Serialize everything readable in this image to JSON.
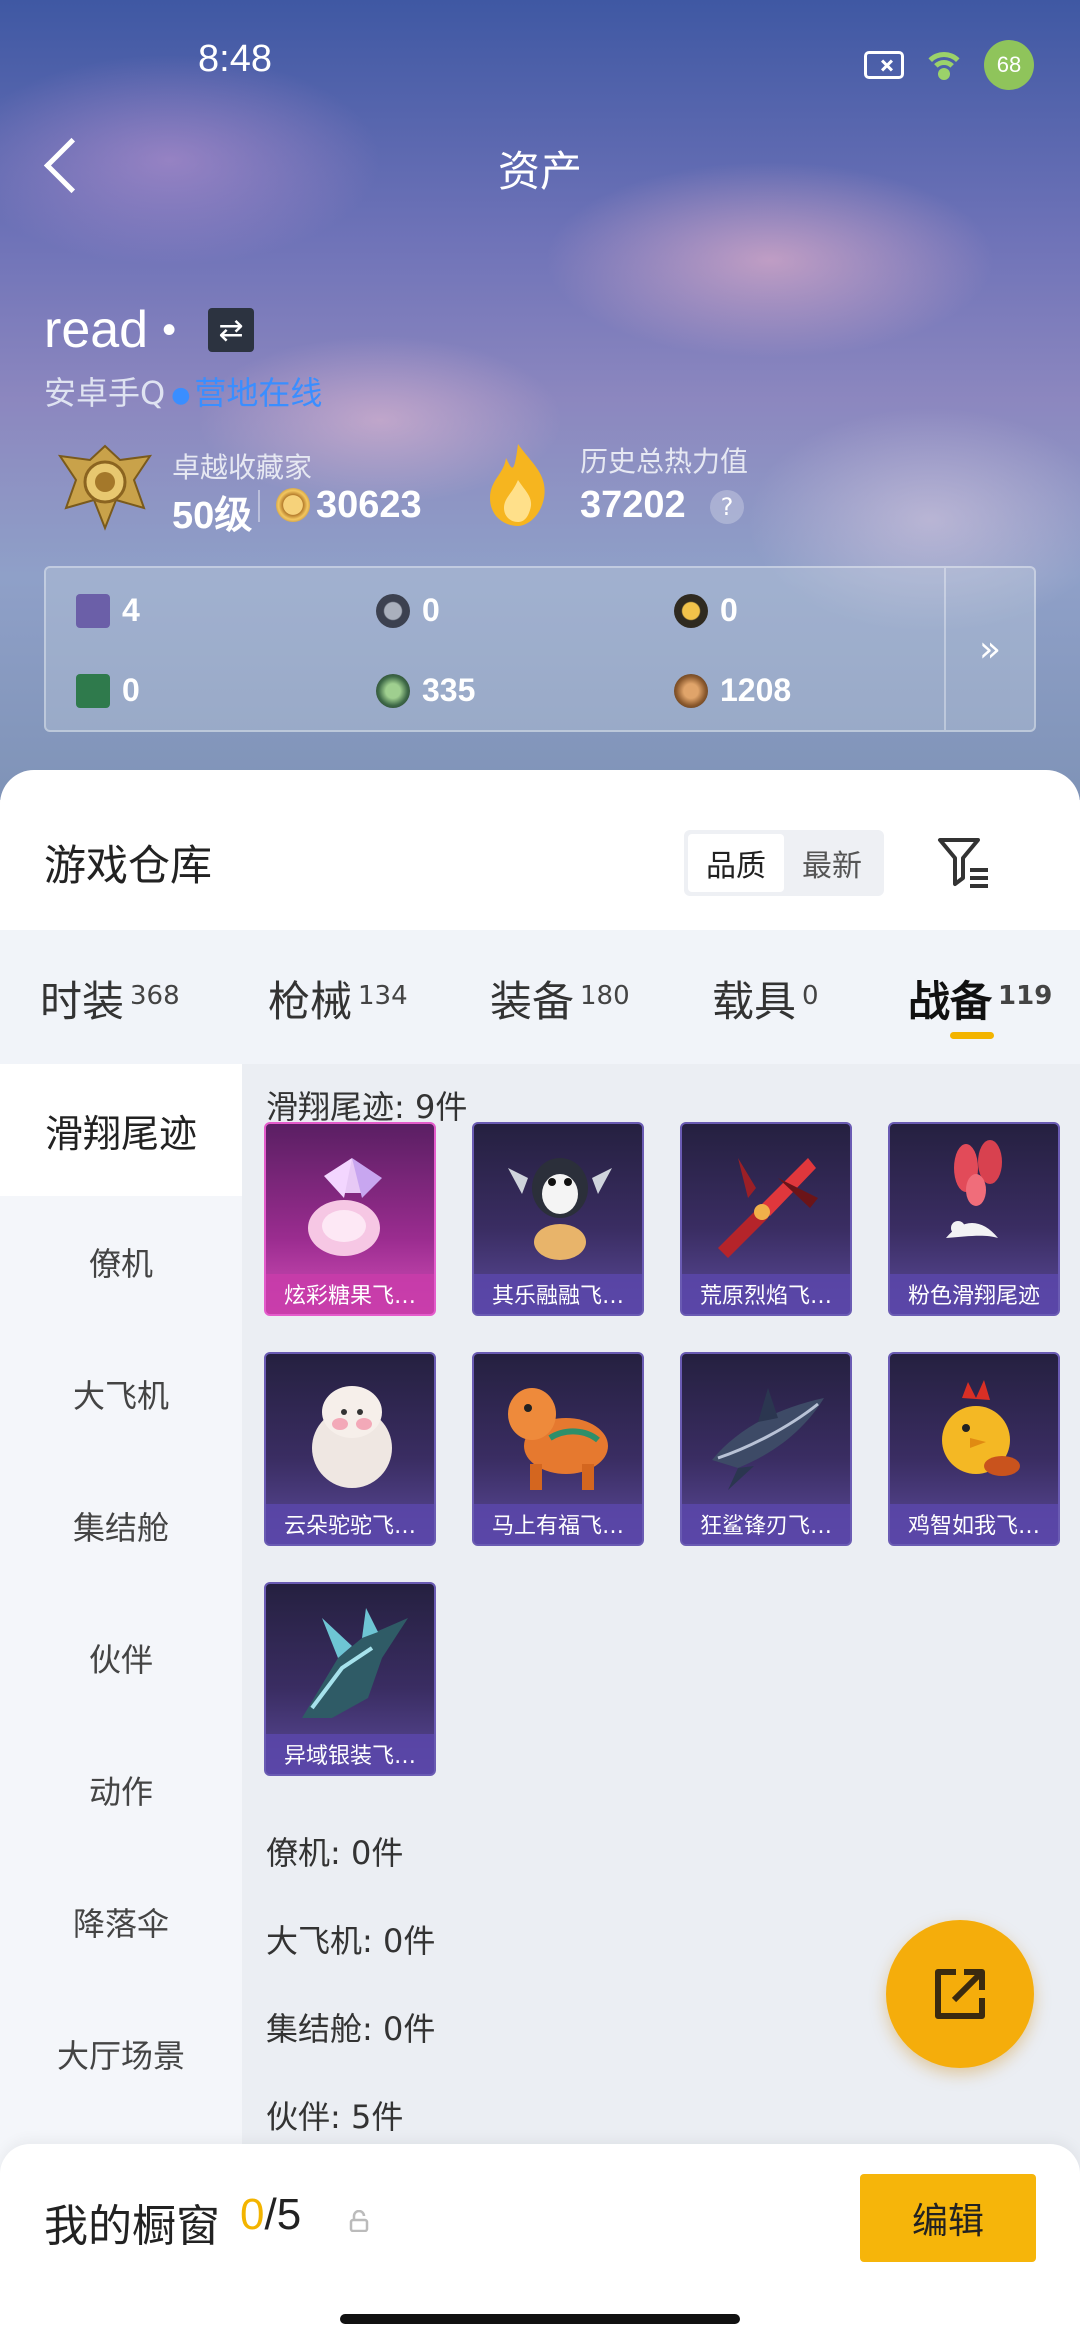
{
  "status_bar": {
    "time": "8:48",
    "battery": "68"
  },
  "header": {
    "title": "资产"
  },
  "profile": {
    "name": "read",
    "dot": "•",
    "switch_symbol": "⇄",
    "platform": "安卓手Q",
    "online_status": "营地在线",
    "collector_title": "卓越收藏家",
    "level": "50级",
    "coins": "30623",
    "heat_label": "历史总热力值",
    "heat_value": "37202",
    "help_symbol": "?"
  },
  "currencies": [
    {
      "icon": "purple-card-icon",
      "value": "4",
      "color": "#6b5fa8"
    },
    {
      "icon": "gray-coin-icon",
      "value": "0",
      "color": "#3c4150"
    },
    {
      "icon": "gold-coin-icon",
      "value": "0",
      "color": "#2f2a20"
    },
    {
      "icon": "green-card-icon",
      "value": "0",
      "color": "#2f7a4c"
    },
    {
      "icon": "green-orb-icon",
      "value": "335",
      "color": "#3f6a48"
    },
    {
      "icon": "bronze-coin-icon",
      "value": "1208",
      "color": "#8c5a2e"
    }
  ],
  "currency_more": "»",
  "warehouse": {
    "title": "游戏仓库",
    "sort_options": [
      "品质",
      "最新"
    ],
    "sort_selected": "品质"
  },
  "tabs": [
    {
      "label": "时装",
      "count": "368"
    },
    {
      "label": "枪械",
      "count": "134"
    },
    {
      "label": "装备",
      "count": "180"
    },
    {
      "label": "载具",
      "count": "0"
    },
    {
      "label": "战备",
      "count": "119"
    }
  ],
  "active_tab": "战备",
  "sidebar": [
    "滑翔尾迹",
    "僚机",
    "大飞机",
    "集结舱",
    "伙伴",
    "动作",
    "降落伞",
    "大厅场景"
  ],
  "sidebar_active": "滑翔尾迹",
  "sections": {
    "glide_trail_label": "滑翔尾迹: 9件",
    "wingman_label": "僚机: 0件",
    "big_plane_label": "大飞机: 0件",
    "pod_label": "集结舱: 0件",
    "partner_label": "伙伴: 5件"
  },
  "items": [
    {
      "name": "炫彩糖果飞…",
      "quality": "pink"
    },
    {
      "name": "其乐融融飞…",
      "quality": "purple"
    },
    {
      "name": "荒原烈焰飞…",
      "quality": "purple"
    },
    {
      "name": "粉色滑翔尾迹",
      "quality": "purple"
    },
    {
      "name": "云朵驼驼飞…",
      "quality": "purple"
    },
    {
      "name": "马上有福飞…",
      "quality": "purple"
    },
    {
      "name": "狂鲨锋刃飞…",
      "quality": "purple"
    },
    {
      "name": "鸡智如我飞…",
      "quality": "purple"
    },
    {
      "name": "异域银装飞…",
      "quality": "purple"
    }
  ],
  "showcase": {
    "label": "我的橱窗",
    "current": "0",
    "total": "/5",
    "edit_label": "编辑"
  }
}
